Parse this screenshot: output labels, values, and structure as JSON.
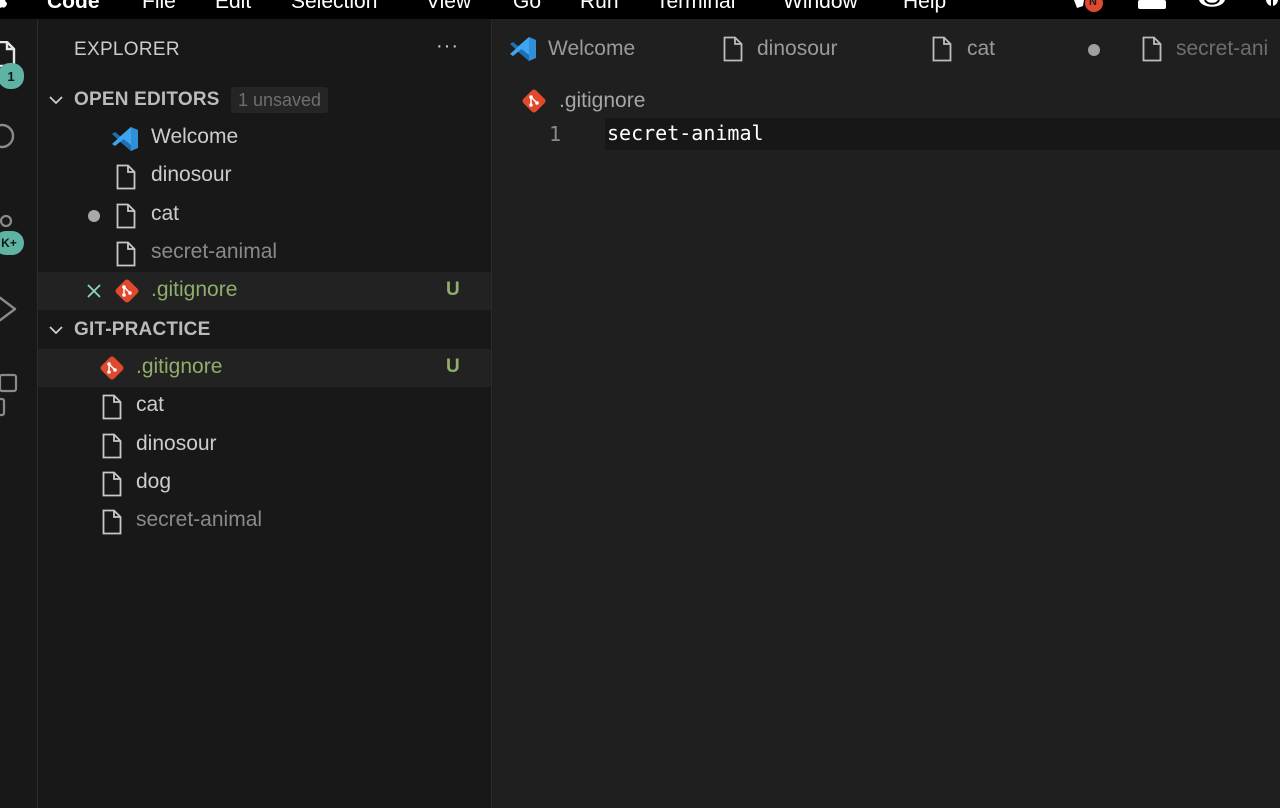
{
  "menubar": {
    "app_name": "Code",
    "items": [
      "File",
      "Edit",
      "Selection",
      "View",
      "Go",
      "Run",
      "Terminal",
      "Window",
      "Help"
    ],
    "notification_badge": "N"
  },
  "activitybar": {
    "explorer_badge": "1",
    "accounts_badge": "K+"
  },
  "sidebar": {
    "title": "EXPLORER",
    "more": "···",
    "open_editors": {
      "title": "OPEN EDITORS",
      "pill": "1 unsaved",
      "items": [
        {
          "label": "Welcome",
          "icon": "vscode-icon"
        },
        {
          "label": "dinosour",
          "icon": "file-icon"
        },
        {
          "label": "cat",
          "icon": "file-icon",
          "unsaved": true
        },
        {
          "label": "secret-animal",
          "icon": "file-icon"
        },
        {
          "label": ".gitignore",
          "icon": "git-icon",
          "status": "U"
        }
      ]
    },
    "folder": {
      "title": "GIT-PRACTICE",
      "items": [
        {
          "label": ".gitignore",
          "icon": "git-icon",
          "status": "U"
        },
        {
          "label": "cat",
          "icon": "file-icon"
        },
        {
          "label": "dinosour",
          "icon": "file-icon"
        },
        {
          "label": "dog",
          "icon": "file-icon"
        },
        {
          "label": "secret-animal",
          "icon": "file-icon"
        }
      ]
    }
  },
  "editor": {
    "tabs": [
      {
        "label": "Welcome",
        "icon": "vscode-icon"
      },
      {
        "label": "dinosour",
        "icon": "file-icon"
      },
      {
        "label": "cat",
        "icon": "file-icon"
      },
      {
        "label": "secret-ani",
        "icon": "file-icon"
      }
    ],
    "breadcrumb": ".gitignore",
    "lines": [
      {
        "number": "1",
        "text": "secret-animal"
      }
    ]
  },
  "colors": {
    "background": "#1e1e1e",
    "sidebar": "#181818",
    "untracked": "#8fae6b",
    "git": "#e0492d",
    "vscode_blue": "#3ea6f0",
    "badge": "#5fb3a3"
  }
}
